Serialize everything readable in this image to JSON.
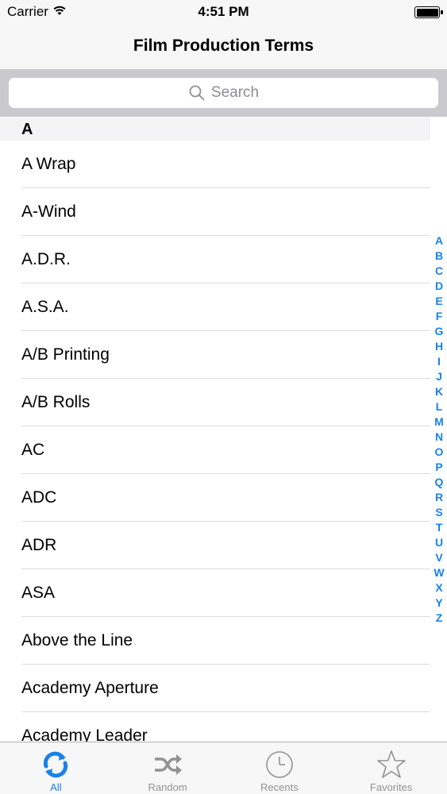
{
  "status_bar": {
    "carrier": "Carrier",
    "time": "4:51 PM"
  },
  "nav": {
    "title": "Film Production Terms"
  },
  "search": {
    "placeholder": "Search"
  },
  "section": {
    "title": "A"
  },
  "terms": [
    "A Wrap",
    "A-Wind",
    "A.D.R.",
    "A.S.A.",
    "A/B Printing",
    "A/B Rolls",
    "AC",
    "ADC",
    "ADR",
    "ASA",
    "Above the Line",
    "Academy Aperture",
    "Academy Leader"
  ],
  "index_letters": [
    "A",
    "B",
    "C",
    "D",
    "E",
    "F",
    "G",
    "H",
    "I",
    "J",
    "K",
    "L",
    "M",
    "N",
    "O",
    "P",
    "Q",
    "R",
    "S",
    "T",
    "U",
    "V",
    "W",
    "X",
    "Y",
    "Z"
  ],
  "tabs": [
    {
      "label": "All",
      "icon": "refresh-icon",
      "active": true
    },
    {
      "label": "Random",
      "icon": "shuffle-icon",
      "active": false
    },
    {
      "label": "Recents",
      "icon": "clock-icon",
      "active": false
    },
    {
      "label": "Favorites",
      "icon": "star-icon",
      "active": false
    }
  ],
  "colors": {
    "accent": "#1a82e6",
    "inactive": "#929292",
    "search_bar_bg": "#c9c9ce"
  }
}
